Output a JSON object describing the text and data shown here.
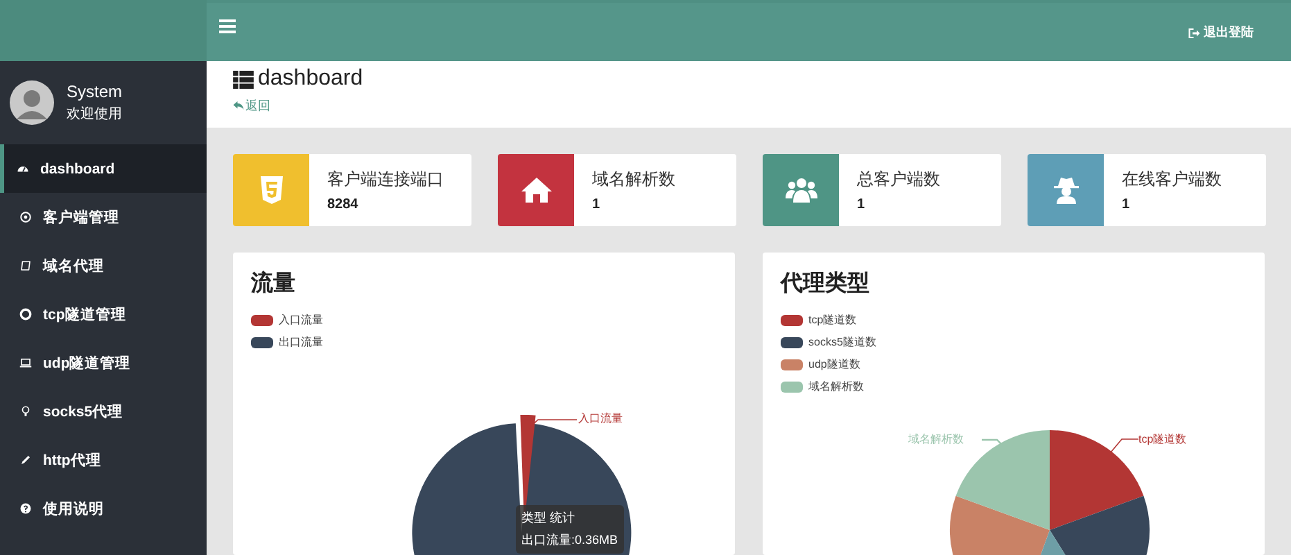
{
  "sidebar": {
    "user": {
      "name": "System",
      "greeting": "欢迎使用"
    },
    "items": [
      {
        "label": "dashboard",
        "selected": true
      },
      {
        "label": "客户端管理",
        "selected": false
      },
      {
        "label": "域名代理",
        "selected": false
      },
      {
        "label": "tcp隧道管理",
        "selected": false
      },
      {
        "label": "udp隧道管理",
        "selected": false
      },
      {
        "label": "socks5代理",
        "selected": false
      },
      {
        "label": "http代理",
        "selected": false
      },
      {
        "label": "使用说明",
        "selected": false
      }
    ]
  },
  "header": {
    "logout": "退出登陆"
  },
  "page": {
    "title": "dashboard",
    "back": "返回"
  },
  "stats": [
    {
      "label": "客户端连接端口",
      "value": "8284",
      "color": "#f0bf2e"
    },
    {
      "label": "域名解析数",
      "value": "1",
      "color": "#c3333f"
    },
    {
      "label": "总客户端数",
      "value": "1",
      "color": "#4f9585"
    },
    {
      "label": "在线客户端数",
      "value": "1",
      "color": "#5e9eb6"
    }
  ],
  "charts": [
    {
      "title": "流量",
      "legend": [
        {
          "label": "入口流量",
          "color": "#b33634"
        },
        {
          "label": "出口流量",
          "color": "#38475a"
        }
      ],
      "slice_labels": [
        {
          "text": "入口流量",
          "color": "#b33634"
        }
      ],
      "tooltip": {
        "title": "类型 统计",
        "body": "出口流量:0.36MB"
      }
    },
    {
      "title": "代理类型",
      "legend": [
        {
          "label": "tcp隧道数",
          "color": "#b33634"
        },
        {
          "label": "socks5隧道数",
          "color": "#38475a"
        },
        {
          "label": "udp隧道数",
          "color": "#c98266"
        },
        {
          "label": "域名解析数",
          "color": "#9bc5ad"
        }
      ],
      "slice_labels": [
        {
          "text": "域名解析数",
          "color": "#9bc5ad"
        },
        {
          "text": "tcp隧道数",
          "color": "#b33634"
        }
      ]
    }
  ]
}
